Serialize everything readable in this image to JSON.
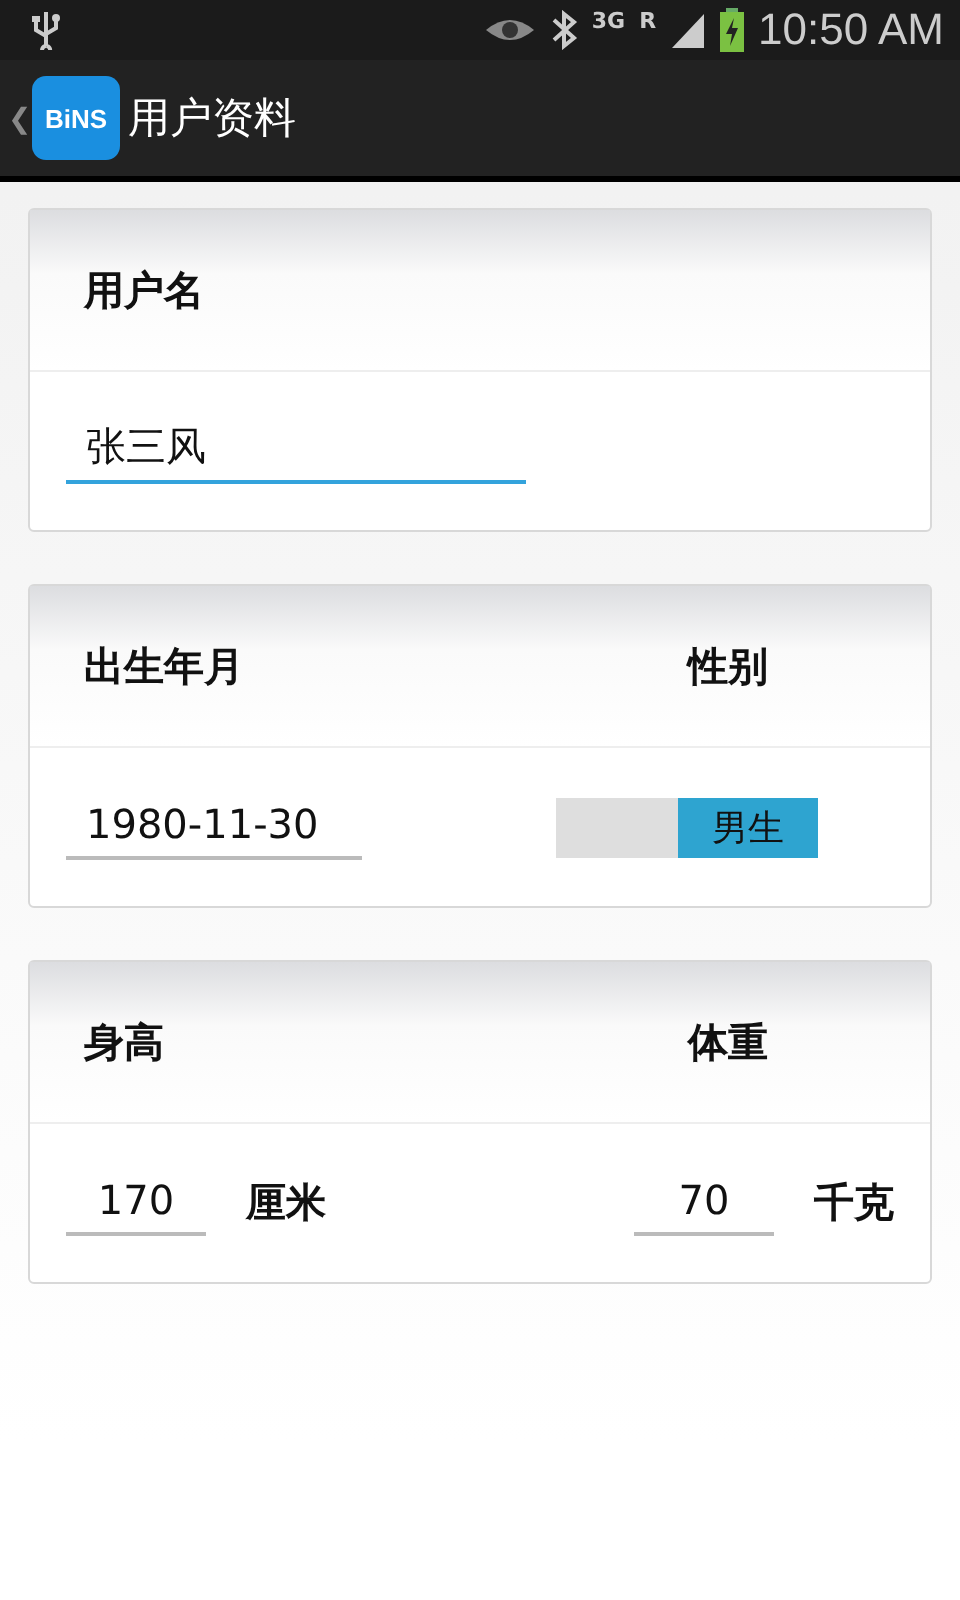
{
  "status_bar": {
    "network": "3G",
    "roaming": "R",
    "time": "10:50 AM"
  },
  "action_bar": {
    "back": "❮",
    "logo": "BiNS",
    "title": "用户资料"
  },
  "cards": [
    {
      "kind": "single",
      "label": "用户名",
      "field": {
        "value": "张三风",
        "focused": true
      }
    },
    {
      "kind": "date_gender",
      "left_label": "出生年月",
      "right_label": "性别",
      "date": {
        "value": "1980-11-30",
        "focused": false
      },
      "gender_switch": {
        "on": true,
        "label": "男生"
      }
    },
    {
      "kind": "measures",
      "left_label": "身高",
      "right_label": "体重",
      "height": {
        "value": "170",
        "focused": false
      },
      "height_unit": "厘米",
      "weight": {
        "value": "70",
        "focused": false
      },
      "weight_unit": "千克"
    }
  ]
}
